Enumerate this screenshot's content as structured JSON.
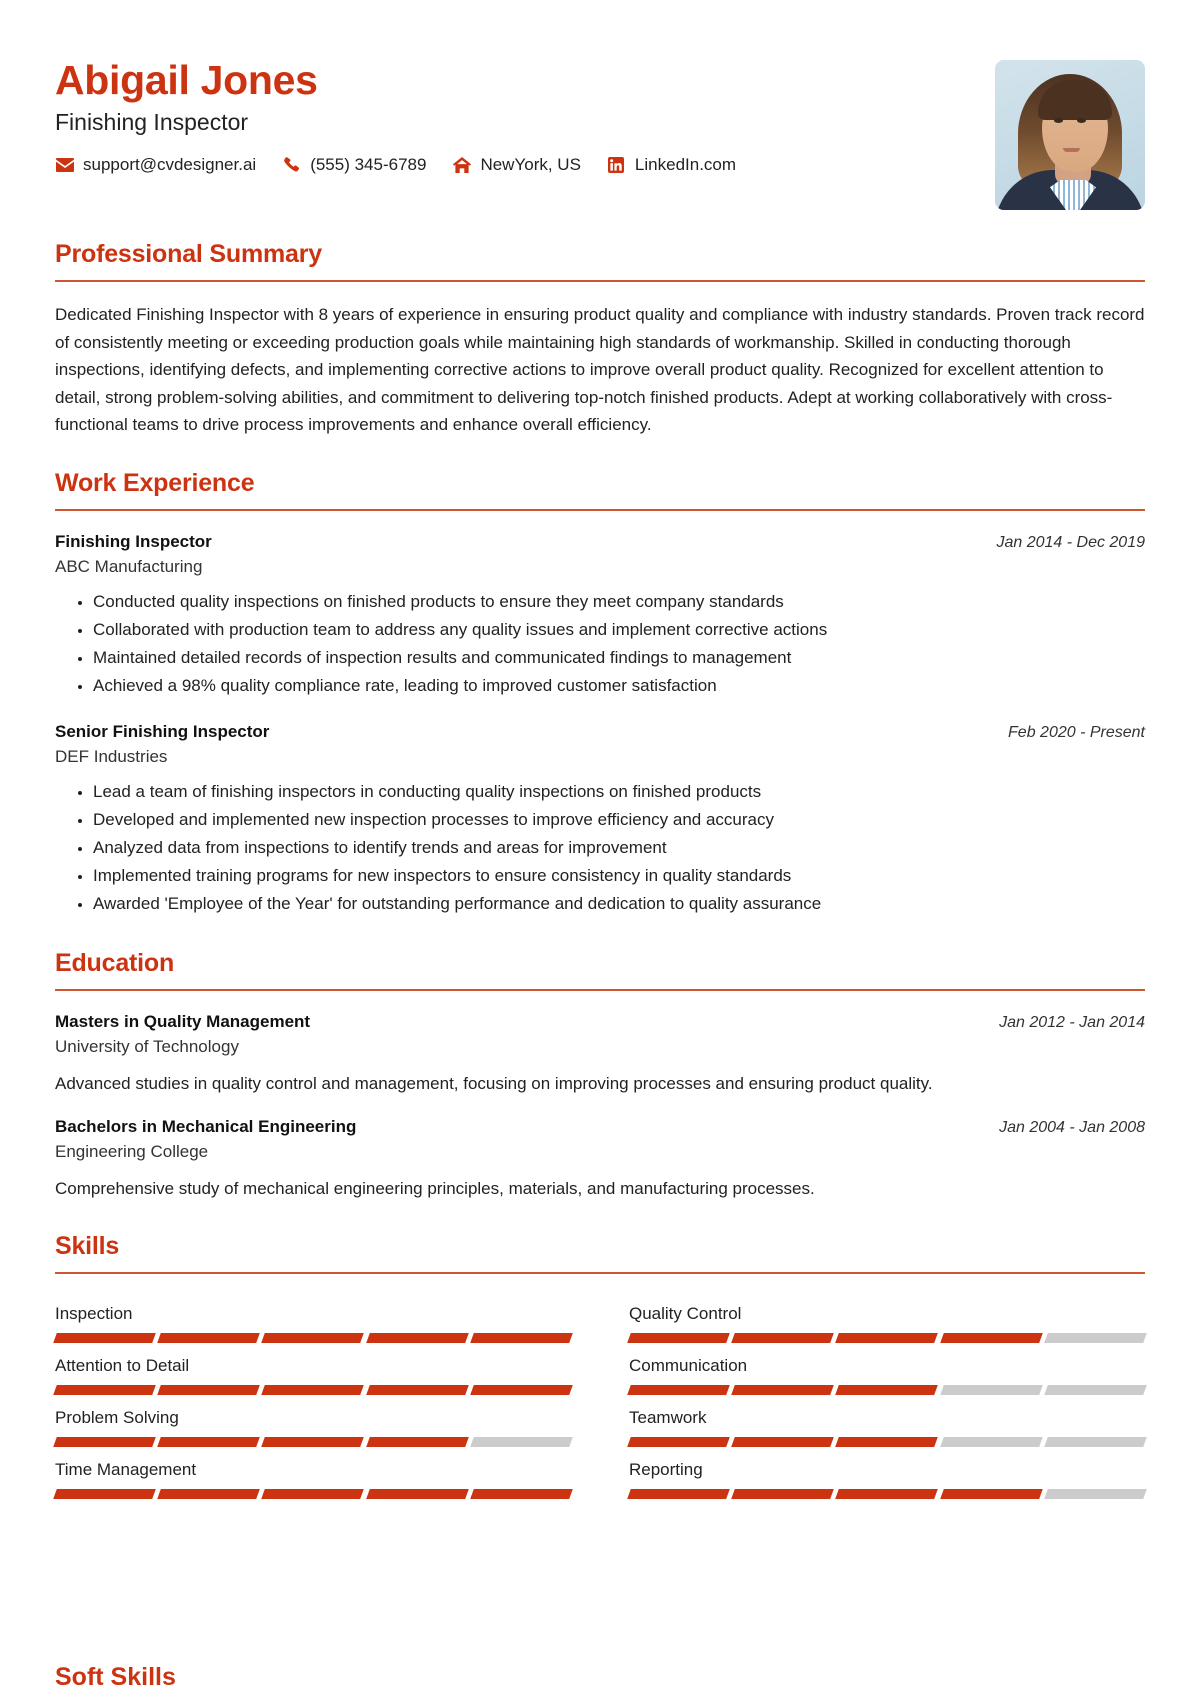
{
  "header": {
    "name": "Abigail Jones",
    "title": "Finishing Inspector",
    "contacts": [
      {
        "icon": "envelope-icon",
        "value": "support@cvdesigner.ai"
      },
      {
        "icon": "phone-icon",
        "value": "(555) 345-6789"
      },
      {
        "icon": "home-icon",
        "value": "NewYork, US"
      },
      {
        "icon": "linkedin-icon",
        "value": "LinkedIn.com"
      }
    ]
  },
  "summary": {
    "heading": "Professional Summary",
    "text": "Dedicated Finishing Inspector with 8 years of experience in ensuring product quality and compliance with industry standards. Proven track record of consistently meeting or exceeding production goals while maintaining high standards of workmanship. Skilled in conducting thorough inspections, identifying defects, and implementing corrective actions to improve overall product quality. Recognized for excellent attention to detail, strong problem-solving abilities, and commitment to delivering top-notch finished products. Adept at working collaboratively with cross-functional teams to drive process improvements and enhance overall efficiency."
  },
  "work": {
    "heading": "Work Experience",
    "entries": [
      {
        "title": "Finishing Inspector",
        "company": "ABC Manufacturing",
        "dates": "Jan 2014 - Dec 2019",
        "bullets": [
          "Conducted quality inspections on finished products to ensure they meet company standards",
          "Collaborated with production team to address any quality issues and implement corrective actions",
          "Maintained detailed records of inspection results and communicated findings to management",
          "Achieved a 98% quality compliance rate, leading to improved customer satisfaction"
        ]
      },
      {
        "title": "Senior Finishing Inspector",
        "company": "DEF Industries",
        "dates": "Feb 2020 - Present",
        "bullets": [
          "Lead a team of finishing inspectors in conducting quality inspections on finished products",
          "Developed and implemented new inspection processes to improve efficiency and accuracy",
          "Analyzed data from inspections to identify trends and areas for improvement",
          "Implemented training programs for new inspectors to ensure consistency in quality standards",
          "Awarded 'Employee of the Year' for outstanding performance and dedication to quality assurance"
        ]
      }
    ]
  },
  "education": {
    "heading": "Education",
    "entries": [
      {
        "degree": "Masters in Quality Management",
        "school": "University of Technology",
        "dates": "Jan 2012 - Jan 2014",
        "description": "Advanced studies in quality control and management, focusing on improving processes and ensuring product quality."
      },
      {
        "degree": "Bachelors in Mechanical Engineering",
        "school": "Engineering College",
        "dates": "Jan 2004 - Jan 2008",
        "description": "Comprehensive study of mechanical engineering principles, materials, and manufacturing processes."
      }
    ]
  },
  "skills": {
    "heading": "Skills",
    "segments_total": 5,
    "items": [
      {
        "name": "Inspection",
        "level": 5
      },
      {
        "name": "Quality Control",
        "level": 4
      },
      {
        "name": "Attention to Detail",
        "level": 5
      },
      {
        "name": "Communication",
        "level": 3
      },
      {
        "name": "Problem Solving",
        "level": 4
      },
      {
        "name": "Teamwork",
        "level": 3
      },
      {
        "name": "Time Management",
        "level": 5
      },
      {
        "name": "Reporting",
        "level": 4
      }
    ]
  },
  "soft_skills": {
    "heading": "Soft Skills"
  },
  "colors": {
    "accent": "#cc3311",
    "rule": "#cc5533",
    "text": "#222222",
    "segment_off": "#cccccc"
  }
}
